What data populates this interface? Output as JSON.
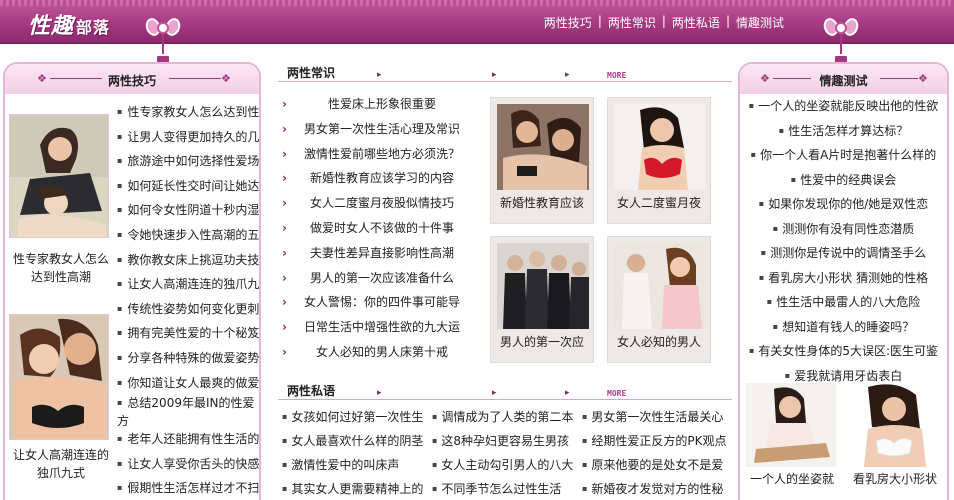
{
  "site": {
    "logo_main": "性趣",
    "logo_sub": "部落"
  },
  "topnav": [
    "两性技巧",
    "两性常识",
    "两性私语",
    "情趣测试"
  ],
  "left": {
    "title": "两性技巧",
    "photo1_caption": "性专家教女人怎么达到性高潮",
    "photo2_caption": "让女人高潮连连的独爪九式",
    "items": [
      "性专家教女人怎么达到性",
      "让男人变得更加持久的几",
      "旅游途中如何选择性爱场",
      "如何延长性交时间让她达",
      "如何令女性阴道十秒内湿",
      "令她快速步入性高潮的五",
      "教你教女床上挑逗功夫技",
      "让女人高潮连连的独爪九",
      "传统性姿势如何变化更刺",
      "拥有完美性爱的十个秘笈",
      "分享各种特殊的做爱姿势",
      "你知道让女人最爽的做爱",
      "总结2009年最IN的性爱方",
      "老年人还能拥有性生活的",
      "让女人享受你舌头的快感",
      "假期性生活怎样过才不扫"
    ]
  },
  "common": {
    "title": "两性常识",
    "more": "MORE",
    "items": [
      "性爱床上形象很重要",
      "男女第一次性生活心理及常识",
      "激情性爱前哪些地方必须洗？",
      "新婚性教育应该学习的内容",
      "女人二度蜜月夜股似情技巧",
      "做爱时女人不该做的十件事",
      "夫妻性差异直接影响性高潮",
      "男人的第一次应该准备什么",
      "女人警惕：你的四件事可能导",
      "日常生活中增强性欲的九大运",
      "女人必知的男人床第十戒"
    ],
    "cards": [
      "新婚性教育应该",
      "女人二度蜜月夜",
      "男人的第一次应",
      "女人必知的男人"
    ]
  },
  "private": {
    "title": "两性私语",
    "more": "MORE",
    "items": [
      "女孩如何过好第一次性生",
      "调情成为了人类的第二本",
      "男女第一次性生活最关心",
      "女人最喜欢什么样的阴茎",
      "这8种孕妇更容易生男孩",
      "经期性爱正反方的PK观点",
      "激情性爱中的叫床声",
      "女人主动勾引男人的八大",
      "原来他要的是处女不是爱",
      "其实女人更需要精神上的",
      "不同季节怎么过性生活",
      "新婚夜才发觉对方的性秘"
    ]
  },
  "quiz": {
    "title": "情趣测试",
    "items": [
      "一个人的坐姿就能反映出他的性欲",
      "性生活怎样才算达标？",
      "你一个人看A片时是抱著什么样的",
      "性爱中的经典误会",
      "如果你发现你的他/她是双性恋",
      "测测你有没有同性恋潜质",
      "测测你是传说中的调情圣手么",
      "看乳房大小形状 猜测她的性格",
      "性生活中最雷人的八大危险",
      "想知道有钱人的睡姿吗？",
      "有关女性身体的5大误区:医生可鉴",
      "爱我就请用牙齿表白"
    ],
    "photo_captions": [
      "一个人的坐姿就",
      "看乳房大小形状"
    ]
  }
}
